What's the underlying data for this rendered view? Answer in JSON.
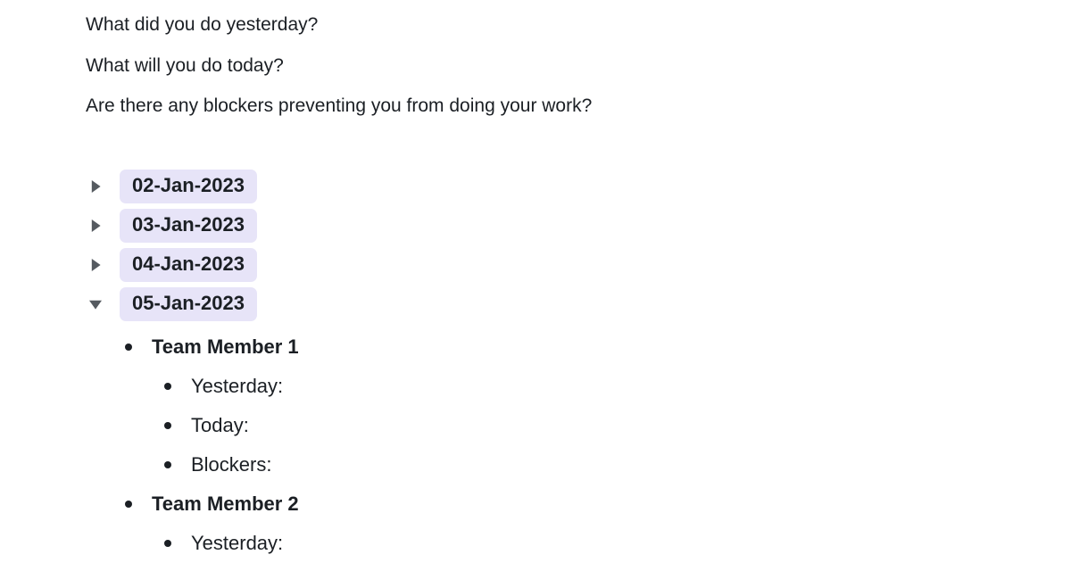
{
  "prompts": {
    "line1": "What did you do yesterday?",
    "line2": "What will you do today?",
    "line3": "Are there any blockers preventing you from doing your work?"
  },
  "dates": {
    "d0": "02-Jan-2023",
    "d1": "03-Jan-2023",
    "d2": "04-Jan-2023",
    "d3": "05-Jan-2023"
  },
  "members": {
    "m1": "Team Member 1",
    "m2": "Team Member 2"
  },
  "fields": {
    "yesterday": "Yesterday:",
    "today": "Today:",
    "blockers": "Blockers:"
  }
}
